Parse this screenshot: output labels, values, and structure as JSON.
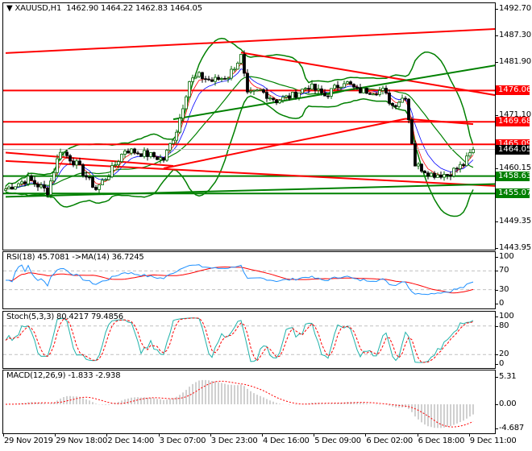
{
  "header": {
    "symbol": "XAUUSD,H1",
    "open": "1462.90",
    "high": "1464.22",
    "low": "1462.83",
    "close": "1464.05"
  },
  "colors": {
    "support": "#008000",
    "resistance": "#ff0000",
    "current": "#000000",
    "rsi": "#1e90ff",
    "stoch_main": "#20b2aa",
    "signal": "#ff0000"
  },
  "chart_data": [
    {
      "type": "candlestick",
      "title": "XAUUSD,H1",
      "ylim": [
        1443.95,
        1492.7
      ],
      "y_ticks": [
        "1492.70",
        "1487.30",
        "1481.90",
        "1471.10",
        "1460.15",
        "1449.35",
        "1443.95"
      ],
      "x_ticks": [
        "29 Nov 2019",
        "29 Nov 18:00",
        "2 Dec 14:00",
        "3 Dec 07:00",
        "3 Dec 23:00",
        "4 Dec 16:00",
        "5 Dec 09:00",
        "6 Dec 02:00",
        "6 Dec 18:00",
        "9 Dec 11:00"
      ],
      "bars": 146,
      "close_path": [
        [
          0,
          1456
        ],
        [
          7,
          1458
        ],
        [
          13,
          1455.5
        ],
        [
          17,
          1464
        ],
        [
          22,
          1461
        ],
        [
          28,
          1456
        ],
        [
          32,
          1459
        ],
        [
          37,
          1464
        ],
        [
          44,
          1463
        ],
        [
          49,
          1462
        ],
        [
          53,
          1468
        ],
        [
          57,
          1478
        ],
        [
          60,
          1479
        ],
        [
          64,
          1478
        ],
        [
          69,
          1479
        ],
        [
          73,
          1483
        ],
        [
          75,
          1475
        ],
        [
          79,
          1476
        ],
        [
          84,
          1474
        ],
        [
          89,
          1475
        ],
        [
          94,
          1477
        ],
        [
          99,
          1475
        ],
        [
          105,
          1478
        ],
        [
          109,
          1476
        ],
        [
          117,
          1476
        ],
        [
          120,
          1473
        ],
        [
          124,
          1475
        ],
        [
          127,
          1461
        ],
        [
          132,
          1459
        ],
        [
          137,
          1459
        ],
        [
          142,
          1461
        ],
        [
          145,
          1464.05
        ]
      ],
      "current_price": "1464.05",
      "levels": [
        {
          "price": "1476.06",
          "kind": "resistance"
        },
        {
          "price": "1469.68",
          "kind": "resistance"
        },
        {
          "price": "1465.09",
          "kind": "resistance"
        },
        {
          "price": "1458.63",
          "kind": "support"
        },
        {
          "price": "1455.07",
          "kind": "support"
        }
      ],
      "trendlines": [
        {
          "kind": "resistance",
          "from": [
            0,
            1483.7
          ],
          "to": [
            152,
            1488.6
          ]
        },
        {
          "kind": "resistance",
          "from": [
            73,
            1483.8
          ],
          "to": [
            152,
            1475.1
          ]
        },
        {
          "kind": "resistance",
          "from": [
            0,
            1463.4
          ],
          "to": [
            52,
            1460.7
          ]
        },
        {
          "kind": "resistance",
          "from": [
            0,
            1461.7
          ],
          "to": [
            152,
            1456.6
          ]
        },
        {
          "kind": "resistance",
          "from": [
            49,
            1460.2
          ],
          "to": [
            124,
            1470.3
          ]
        },
        {
          "kind": "resistance",
          "from": [
            124,
            1470.3
          ],
          "to": [
            145,
            1469.2
          ]
        },
        {
          "kind": "support",
          "from": [
            0,
            1454.4
          ],
          "to": [
            152,
            1457.0
          ]
        },
        {
          "kind": "support",
          "from": [
            52,
            1470.2
          ],
          "to": [
            152,
            1481.2
          ]
        }
      ],
      "bollinger": {
        "period": 20,
        "deviations": 2
      }
    },
    {
      "type": "line",
      "title": "RSI(18) 45.7081  ->MA(14) 36.7245",
      "ylim": [
        0,
        100
      ],
      "levels": [
        30,
        70
      ],
      "y_ticks": [
        "100",
        "70",
        "30",
        "0"
      ]
    },
    {
      "type": "line",
      "title": "Stoch(5,3,3) 80.4217 79.4856",
      "ylim": [
        0,
        100
      ],
      "levels": [
        20,
        80
      ],
      "y_ticks": [
        "100",
        "80",
        "20",
        "0"
      ]
    },
    {
      "type": "bar",
      "title": "MACD(12,26,9) -1.833 -2.938",
      "ylim": [
        -4.687,
        5.31
      ],
      "y_ticks": [
        "5.31",
        "0.00",
        "-4.687"
      ]
    }
  ]
}
